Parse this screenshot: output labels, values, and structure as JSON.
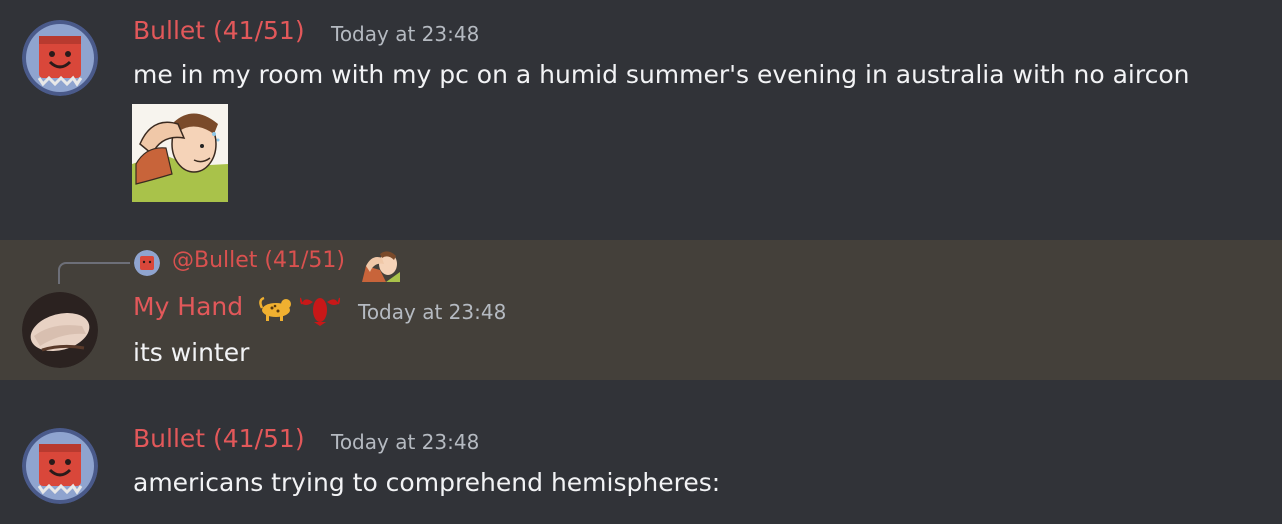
{
  "colors": {
    "background": "#313338",
    "mention_highlight": "#44403a",
    "username_color": "#e2585a",
    "reply_username_color": "#d9514f"
  },
  "messages": [
    {
      "author": "Bullet (41/51)",
      "timestamp": "Today at 23:48",
      "text": "me in my room with my pc on a humid summer's evening in australia with no aircon",
      "avatar_icon": "smiling-box-avatar",
      "attachment_icon": "sweating-man-wiping-forehead-sticker"
    },
    {
      "reply_to": {
        "author": "@Bullet (41/51)",
        "avatar_icon": "smiling-box-avatar",
        "preview_icon": "sweating-man-sticker-thumbnail"
      },
      "author": "My Hand",
      "role_icons": [
        "leopard-icon",
        "lobster-icon"
      ],
      "timestamp": "Today at 23:48",
      "text": "its winter",
      "avatar_icon": "hand-photo-avatar"
    },
    {
      "author": "Bullet (41/51)",
      "timestamp": "Today at 23:48",
      "text": "americans trying to comprehend hemispheres:",
      "avatar_icon": "smiling-box-avatar"
    }
  ]
}
